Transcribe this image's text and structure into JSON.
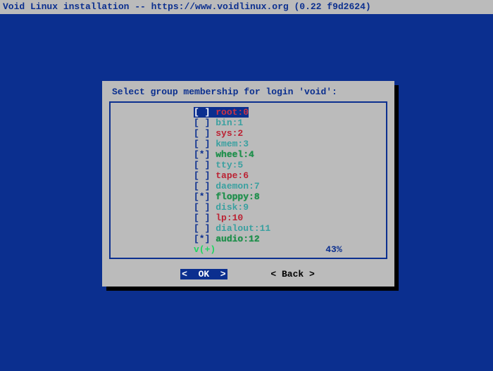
{
  "titlebar": "Void Linux installation -- https://www.voidlinux.org (0.22 f9d2624)",
  "dialog": {
    "prompt": "Select group membership for login 'void':",
    "percent_label": "v(+)",
    "percent_value": "43%",
    "items": [
      {
        "mark": " ",
        "name": "root:0",
        "selected": true
      },
      {
        "mark": " ",
        "name": "bin:1",
        "selected": false
      },
      {
        "mark": " ",
        "name": "sys:2",
        "selected": false
      },
      {
        "mark": " ",
        "name": "kmem:3",
        "selected": false
      },
      {
        "mark": "*",
        "name": "wheel:4",
        "selected": false
      },
      {
        "mark": " ",
        "name": "tty:5",
        "selected": false
      },
      {
        "mark": " ",
        "name": "tape:6",
        "selected": false
      },
      {
        "mark": " ",
        "name": "daemon:7",
        "selected": false
      },
      {
        "mark": "*",
        "name": "floppy:8",
        "selected": false
      },
      {
        "mark": " ",
        "name": "disk:9",
        "selected": false
      },
      {
        "mark": " ",
        "name": "lp:10",
        "selected": false
      },
      {
        "mark": " ",
        "name": "dialout:11",
        "selected": false
      },
      {
        "mark": "*",
        "name": "audio:12",
        "selected": false
      }
    ],
    "buttons": {
      "ok": "<  OK  >",
      "back": "< Back >"
    }
  }
}
